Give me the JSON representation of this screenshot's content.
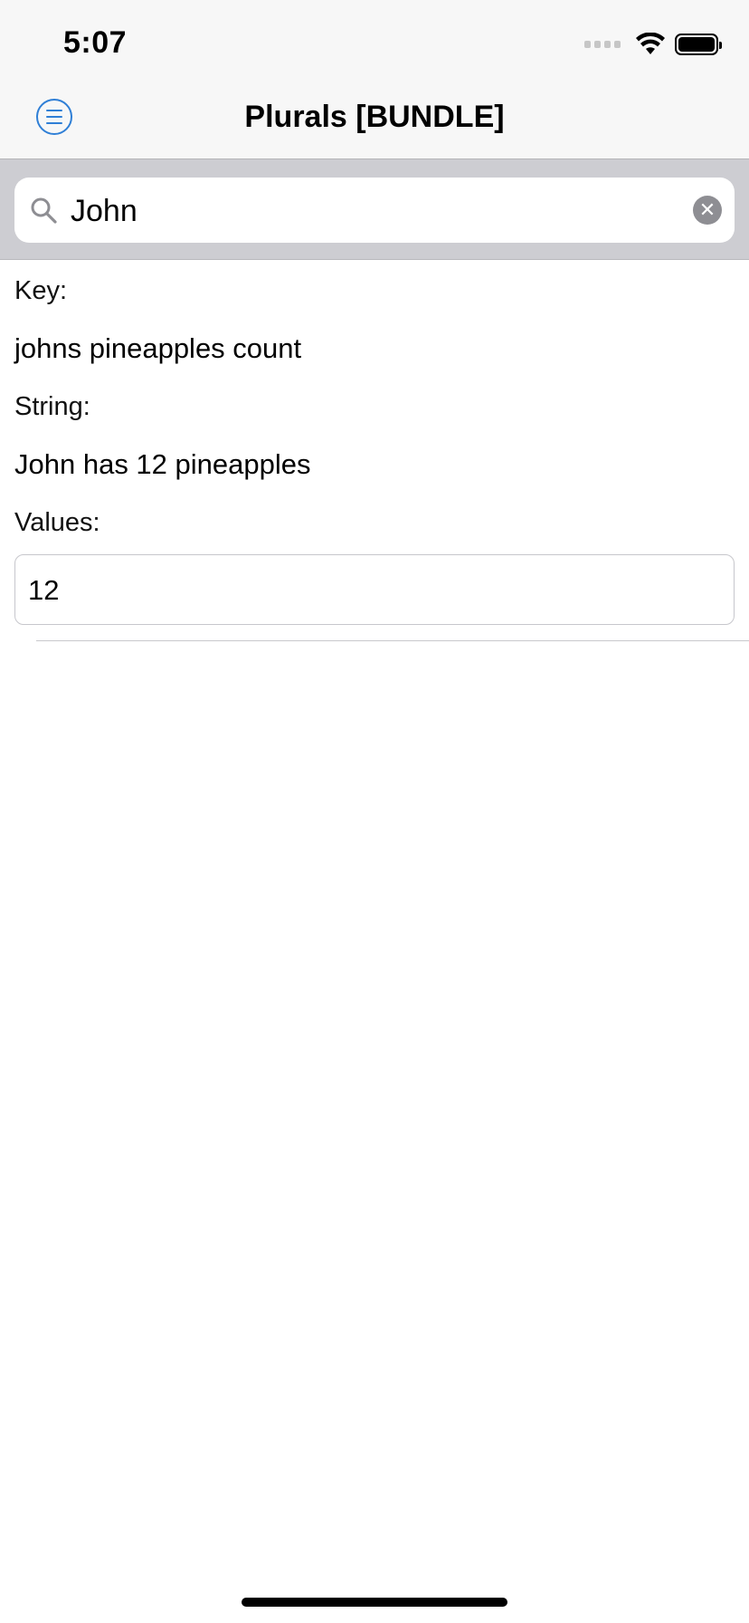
{
  "status_bar": {
    "time": "5:07",
    "icons": [
      "cellular-signal-icon",
      "wifi-icon",
      "battery-icon"
    ]
  },
  "nav": {
    "title": "Plurals [BUNDLE]",
    "menu_icon": "menu-list-icon"
  },
  "search": {
    "value": "John",
    "icon": "search-icon",
    "clear_icon": "clear-icon",
    "clear_glyph": "✕"
  },
  "detail": {
    "key_label": "Key:",
    "key_value": "johns pineapples count",
    "string_label": "String:",
    "string_value": "John has 12 pineapples",
    "values_label": "Values:",
    "values_value": "12"
  },
  "colors": {
    "accent": "#2f7fd6",
    "bar_background": "#f7f7f7",
    "search_background": "#cdcdd2"
  }
}
